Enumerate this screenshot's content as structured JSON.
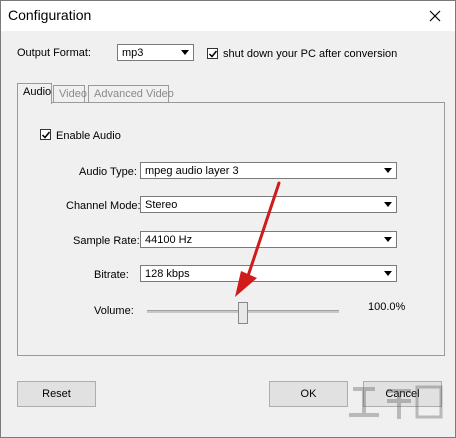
{
  "window": {
    "title": "Configuration"
  },
  "output_format": {
    "label": "Output Format:",
    "value": "mp3"
  },
  "shutdown": {
    "label": "shut down your PC after conversion",
    "checked": true
  },
  "tabs": [
    {
      "label": "Audio",
      "active": true
    },
    {
      "label": "Video",
      "active": false
    },
    {
      "label": "Advanced Video",
      "active": false
    }
  ],
  "audio": {
    "enable_label": "Enable Audio",
    "enable_checked": true,
    "audio_type": {
      "label": "Audio Type:",
      "value": "mpeg audio layer 3"
    },
    "channel_mode": {
      "label": "Channel Mode:",
      "value": "Stereo"
    },
    "sample_rate": {
      "label": "Sample Rate:",
      "value": "44100 Hz"
    },
    "bitrate": {
      "label": "Bitrate:",
      "value": "128 kbps"
    },
    "volume": {
      "label": "Volume:",
      "value_text": "100.0%",
      "level": 0.5
    }
  },
  "buttons": {
    "reset": "Reset",
    "ok": "OK",
    "cancel": "Cancel"
  },
  "colors": {
    "annotation_arrow": "#d11a1a"
  },
  "icons": {
    "close": "close-icon",
    "dropdown": "chevron-down-icon",
    "check": "checkmark-icon"
  }
}
